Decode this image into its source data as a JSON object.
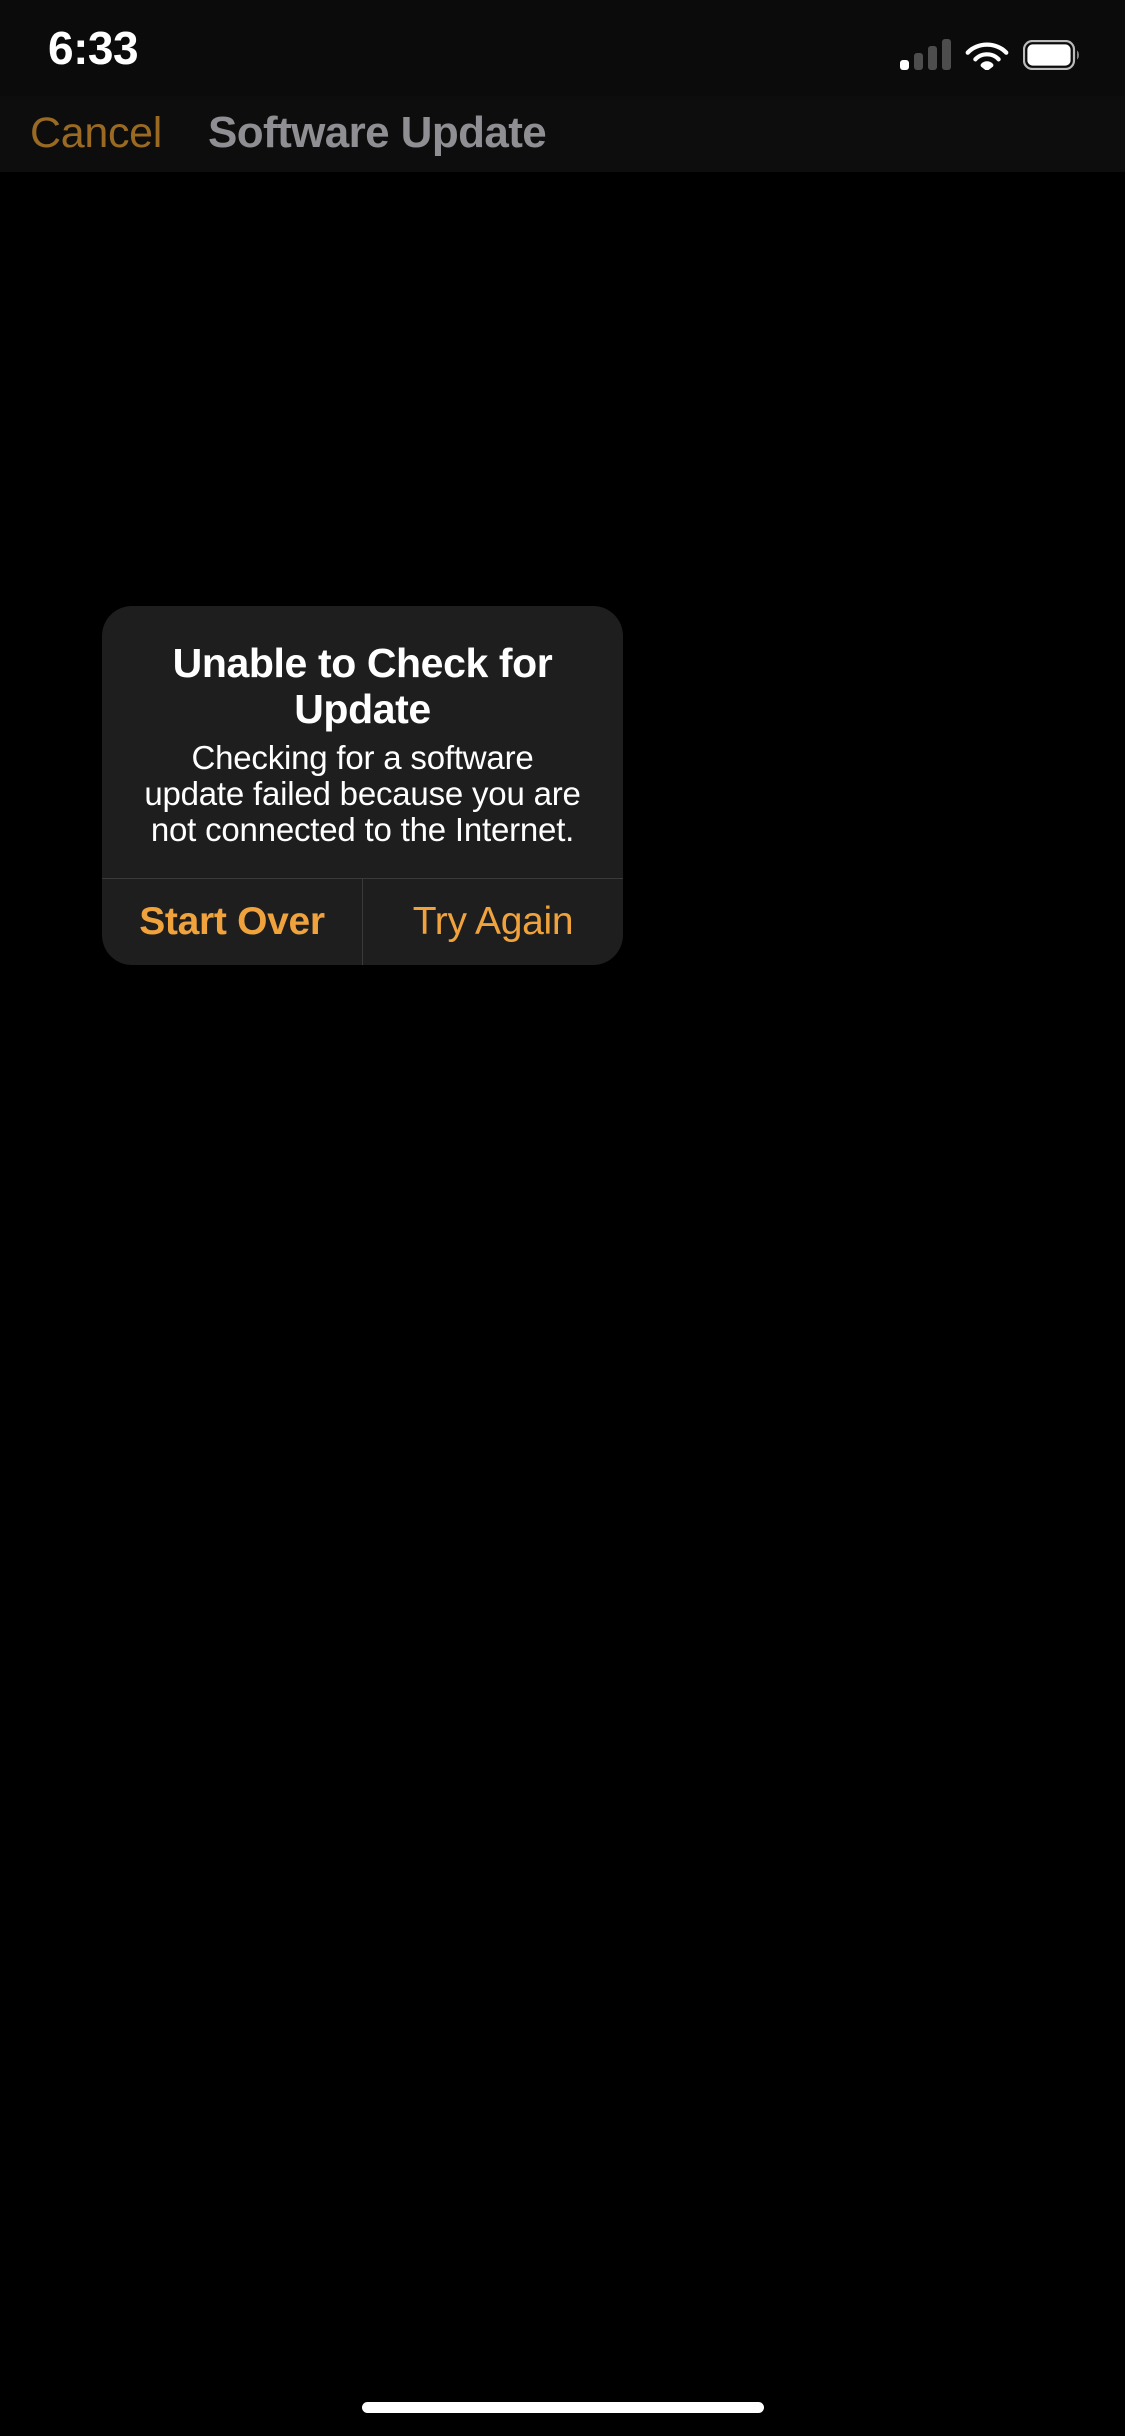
{
  "status_bar": {
    "time": "6:33",
    "cellular": {
      "icon": "cellular-signal-icon",
      "bars_total": 4,
      "bars_active": 1
    },
    "wifi": {
      "icon": "wifi-icon",
      "strength": "full"
    },
    "battery": {
      "icon": "battery-icon",
      "state": "full"
    }
  },
  "nav_bar": {
    "cancel_label": "Cancel",
    "title": "Software Update",
    "cancel_color": "#9a6a22",
    "title_color": "#8e8e93"
  },
  "alert": {
    "title": "Unable to Check for Update",
    "message": "Checking for a software update failed because you are not connected to the Internet.",
    "background": "#1e1e1e",
    "accent_color": "#f0a33c",
    "actions": [
      {
        "label": "Start Over",
        "emphasis": "bold"
      },
      {
        "label": "Try Again",
        "emphasis": "regular"
      }
    ]
  },
  "home_indicator": {
    "name": "home-indicator"
  }
}
